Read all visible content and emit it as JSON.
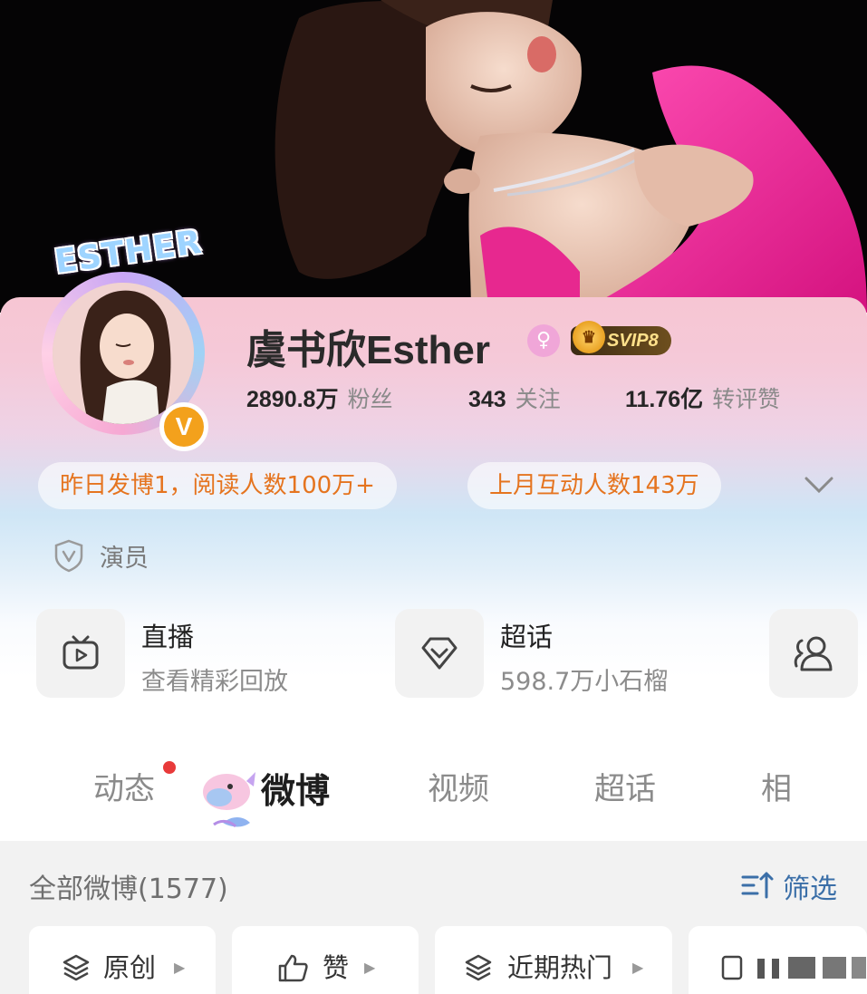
{
  "profile": {
    "name": "虞书欣Esther",
    "frame_text": "ESTHER",
    "verified_mark": "V",
    "gender_mark": "♀",
    "vip_label": "SVIP8",
    "stats": [
      {
        "value": "2890.8万",
        "label": "粉丝"
      },
      {
        "value": "343",
        "label": "关注"
      },
      {
        "value": "11.76亿",
        "label": "转评赞"
      }
    ],
    "highlights": [
      "昨日发博1，阅读人数100万+",
      "上月互动人数143万"
    ],
    "occupation": "演员"
  },
  "features": [
    {
      "title": "直播",
      "subtitle": "查看精彩回放",
      "icon": "tv-icon"
    },
    {
      "title": "超话",
      "subtitle": "598.7万小石榴",
      "icon": "diamond-icon"
    },
    {
      "icon": "group-icon"
    }
  ],
  "tabs": [
    "动态",
    "微博",
    "视频",
    "超话",
    "相"
  ],
  "active_tab": "微博",
  "list": {
    "title": "全部微博(1577)",
    "filter_label": "筛选",
    "chips": [
      "原创",
      "赞",
      "近期热门"
    ]
  },
  "colors": {
    "accent_orange": "#e5741f",
    "filter_blue": "#3b6fa8",
    "vip_gold": "#ffe08a",
    "badge_orange": "#f3a11c"
  }
}
